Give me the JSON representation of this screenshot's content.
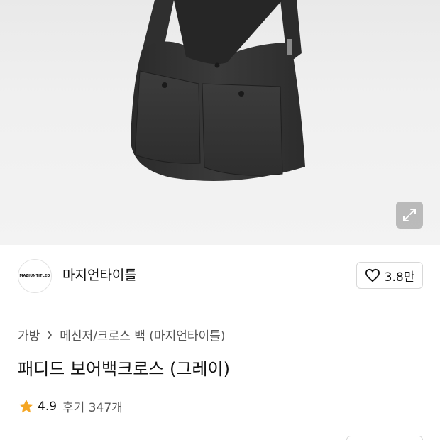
{
  "hero": {
    "image_alt": "product-photo",
    "expand_icon": "expand-arrows-icon"
  },
  "brand": {
    "logo_text": "MAZIUNTITLED",
    "name": "마지언타이틀",
    "like_icon": "heart-outline-icon",
    "like_count": "3.8만"
  },
  "breadcrumb": {
    "items": [
      "가방",
      "메신저/크로스 백 (마지언타이틀)"
    ],
    "separator_icon": "chevron-right-icon"
  },
  "product": {
    "title": "패디드 보어백크로스 (그레이)"
  },
  "rating": {
    "star_icon": "star-icon",
    "star_color": "#f5a623",
    "score": "4.9",
    "reviews_label": "후기 347개"
  }
}
